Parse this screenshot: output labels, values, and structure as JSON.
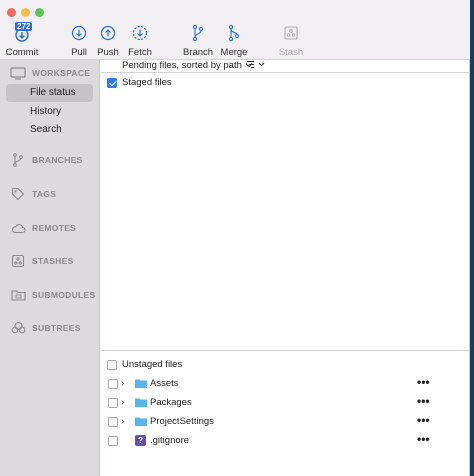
{
  "toolbar": {
    "commit_badge": "272",
    "buttons": {
      "commit": "Commit",
      "pull": "Pull",
      "push": "Push",
      "fetch": "Fetch",
      "branch": "Branch",
      "merge": "Merge",
      "stash": "Stash"
    }
  },
  "sidebar": {
    "workspace": "WORKSPACE",
    "items": [
      "File status",
      "History",
      "Search"
    ],
    "branches": "BRANCHES",
    "tags": "TAGS",
    "remotes": "REMOTES",
    "stashes": "STASHES",
    "submodules": "SUBMODULES",
    "subtrees": "SUBTREES"
  },
  "main": {
    "sort_label": "Pending files, sorted by path",
    "staged_label": "Staged files",
    "unstaged_label": "Unstaged files",
    "unstaged_files": [
      {
        "name": "Assets",
        "type": "folder"
      },
      {
        "name": "Packages",
        "type": "folder"
      },
      {
        "name": "ProjectSettings",
        "type": "folder"
      },
      {
        "name": ".gitignore",
        "type": "unknown"
      }
    ],
    "unknown_glyph": "?",
    "more_glyph": "•••",
    "chevron_glyph": "›"
  },
  "colors": {
    "accent": "#2f7ae5",
    "folder": "#59b4e9",
    "sidebar_bg": "#dcdadc",
    "toolbar_bg": "#f1eff1"
  }
}
